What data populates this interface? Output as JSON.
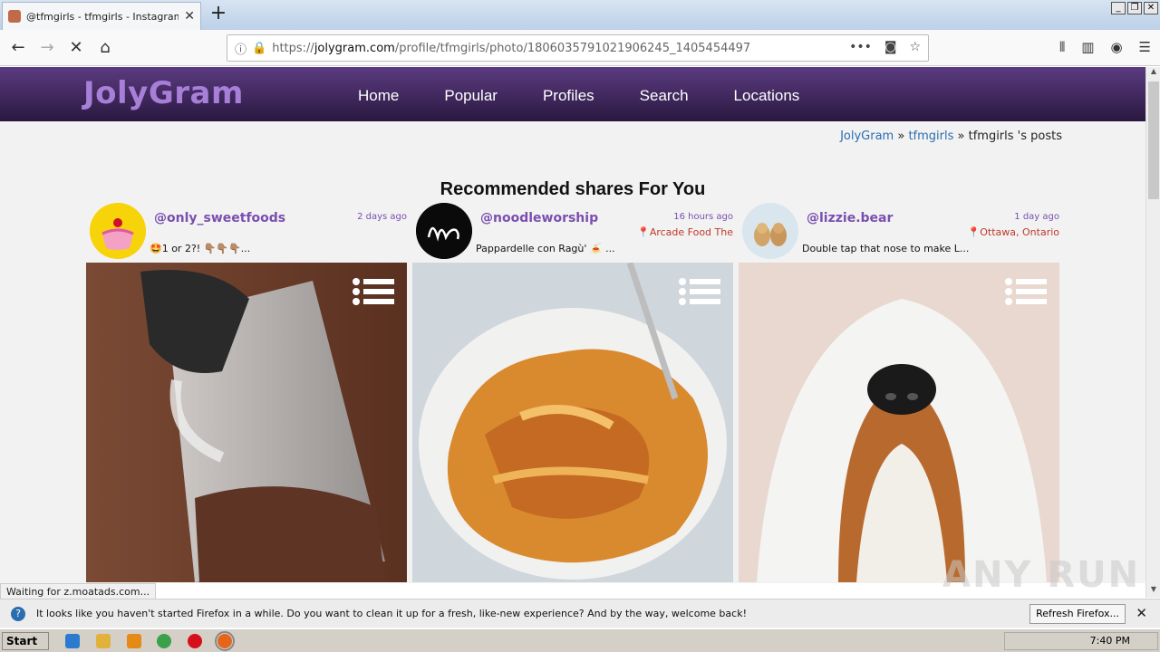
{
  "browser": {
    "tab_title": "@tfmgirls - tfmgirls - Instagram Po",
    "url_prefix": "https://",
    "url_domain": "jolygram.com",
    "url_path": "/profile/tfmgirls/photo/1806035791021906245_1405454497"
  },
  "site": {
    "logo": "JolyGram",
    "nav": [
      "Home",
      "Popular",
      "Profiles",
      "Search",
      "Locations"
    ]
  },
  "breadcrumb": {
    "home": "JolyGram",
    "sep1": " » ",
    "user": "tfmgirls",
    "sep2": " » ",
    "current": "tfmgirls 's posts"
  },
  "section_title": "Recommended shares For You",
  "cards": [
    {
      "username": "@only_sweetfoods",
      "time": "2 days ago",
      "location": "",
      "caption": "🤩1 or 2?! 👇🏽👇🏽👇🏽..."
    },
    {
      "username": "@noodleworship",
      "time": "16 hours ago",
      "location": "Arcade Food The",
      "caption": "Pappardelle con Ragù' 🍝 ..."
    },
    {
      "username": "@lizzie.bear",
      "time": "1 day ago",
      "location": "Ottawa, Ontario",
      "caption": "Double tap that nose to make L..."
    }
  ],
  "status_text": "Waiting for z.moatads.com...",
  "notification": {
    "message": "It looks like you haven't started Firefox in a while. Do you want to clean it up for a fresh, like-new experience? And by the way, welcome back!",
    "button": "Refresh Firefox..."
  },
  "taskbar": {
    "start": "Start",
    "clock": "7:40 PM"
  },
  "watermark": "ANY RUN"
}
